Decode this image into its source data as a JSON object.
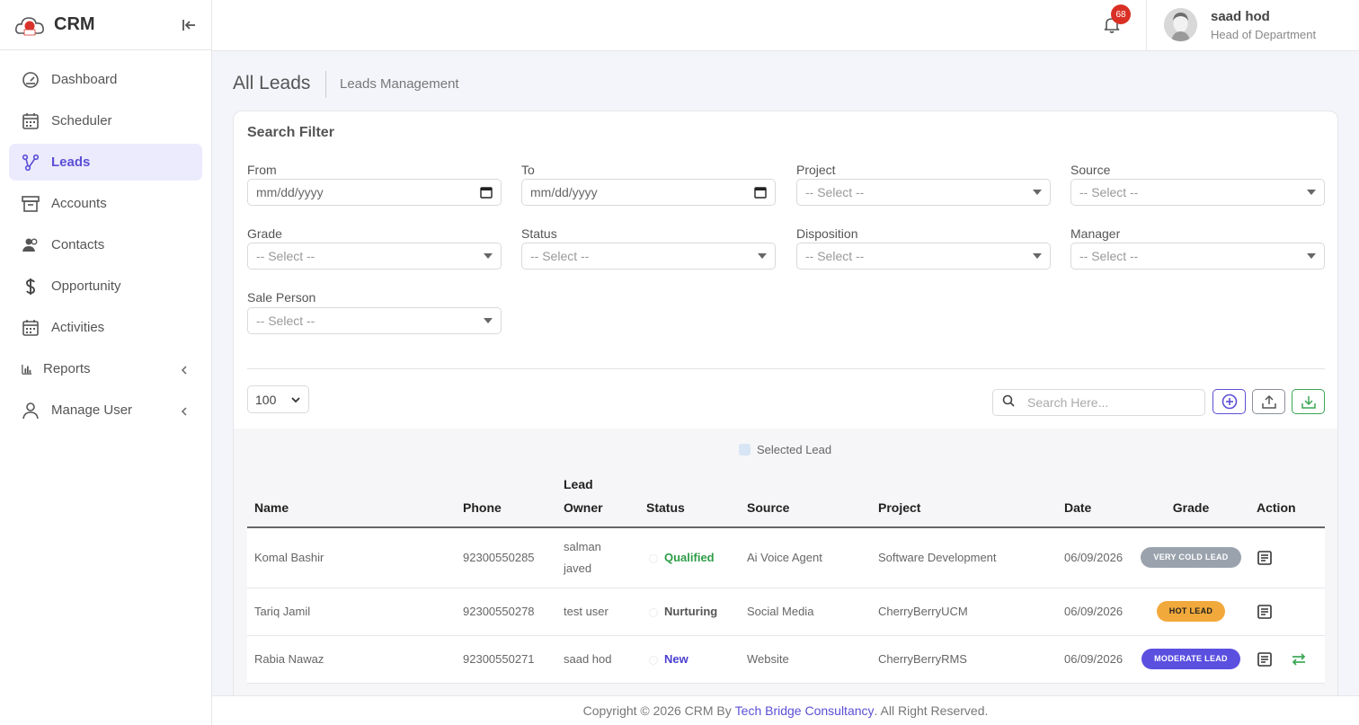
{
  "brand": {
    "name": "CRM"
  },
  "sidebar": {
    "items": [
      {
        "label": "Dashboard",
        "icon": "gauge-icon"
      },
      {
        "label": "Scheduler",
        "icon": "calendar-icon"
      },
      {
        "label": "Leads",
        "icon": "network-icon",
        "active": true
      },
      {
        "label": "Accounts",
        "icon": "archive-icon"
      },
      {
        "label": "Contacts",
        "icon": "users-icon"
      },
      {
        "label": "Opportunity",
        "icon": "dollar-icon"
      },
      {
        "label": "Activities",
        "icon": "calendar-icon"
      },
      {
        "label": "Reports",
        "icon": "bar-chart-icon"
      },
      {
        "label": "Manage User",
        "icon": "user-icon"
      }
    ]
  },
  "topbar": {
    "notification_count": "68",
    "user_name": "saad hod",
    "user_role": "Head of Department"
  },
  "page": {
    "title": "All Leads",
    "subtitle": "Leads Management"
  },
  "filter": {
    "title": "Search Filter",
    "from": {
      "label": "From",
      "value": "mm/dd/yyyy"
    },
    "to": {
      "label": "To",
      "value": "mm/dd/yyyy"
    },
    "project": {
      "label": "Project",
      "value": "-- Select --"
    },
    "source": {
      "label": "Source",
      "value": "-- Select --"
    },
    "grade": {
      "label": "Grade",
      "value": "-- Select --"
    },
    "status": {
      "label": "Status",
      "value": "-- Select --"
    },
    "disposition": {
      "label": "Disposition",
      "value": "-- Select --"
    },
    "manager": {
      "label": "Manager",
      "value": "-- Select --"
    },
    "sale_person": {
      "label": "Sale Person",
      "value": "-- Select --"
    }
  },
  "toolbar": {
    "page_size": "100",
    "search_placeholder": "Search Here..."
  },
  "legend": {
    "selected": "Selected Lead"
  },
  "table": {
    "headers": {
      "name": "Name",
      "phone": "Phone",
      "owner_line1": "Lead",
      "owner_line2": "Owner",
      "status": "Status",
      "source": "Source",
      "project": "Project",
      "date": "Date",
      "grade": "Grade",
      "action": "Action"
    },
    "rows": [
      {
        "name": "Komal Bashir",
        "phone": "92300550285",
        "owner_line1": "salman",
        "owner_line2": "javed",
        "status": "Qualified",
        "source": "Ai Voice Agent",
        "project": "Software Development",
        "date": "06/09/2026",
        "grade": "VERY COLD LEAD",
        "grade_color": "#9aa3ad"
      },
      {
        "name": "Tariq Jamil",
        "phone": "92300550278",
        "owner": "test user",
        "status": "Nurturing",
        "source": "Social Media",
        "project": "CherryBerryUCM",
        "date": "06/09/2026",
        "grade": "HOT LEAD",
        "grade_color": "#f2a93b"
      },
      {
        "name": "Rabia Nawaz",
        "phone": "92300550271",
        "owner": "saad hod",
        "status": "New",
        "source": "Website",
        "project": "CherryBerryRMS",
        "date": "06/09/2026",
        "grade": "MODERATE LEAD",
        "grade_color": "#5b4fe0"
      }
    ]
  },
  "footer": {
    "prefix": "Copyright © 2026 CRM By ",
    "company": "Tech Bridge Consultancy",
    "suffix": ". All Right Reserved."
  }
}
